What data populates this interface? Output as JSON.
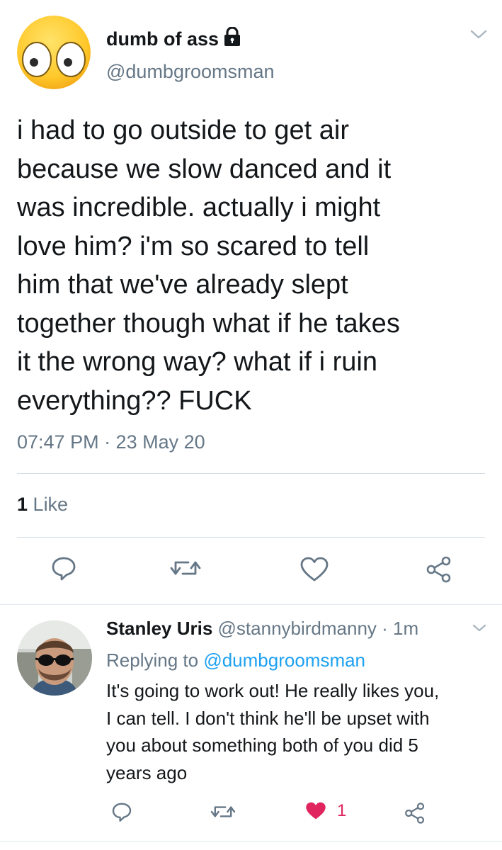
{
  "tweet": {
    "display_name": "dumb of ass",
    "handle": "@dumbgroomsman",
    "text": "i had to go outside to get air\nbecause we slow danced and it\nwas incredible. actually i might\nlove him? i'm so scared to tell\nhim that we've already slept\ntogether though what if he takes\nit the wrong way? what if i ruin\neverything?? FUCK",
    "timestamp": "07:47 PM · 23 May 20",
    "like_count": "1",
    "like_label": "Like",
    "protected_icon": "lock-icon",
    "avatar_icon": "surprised-face-emoji"
  },
  "actions": [
    "reply-icon",
    "retweet-icon",
    "like-icon",
    "share-icon"
  ],
  "reply": {
    "display_name": "Stanley Uris",
    "handle": "@stannybirdmanny",
    "time": "· 1m",
    "replying_label": "Replying to",
    "replying_to": "@dumbgroomsman",
    "text": "It's going to work out! He really likes you,\nI can tell. I don't think he'll be upset with\nyou about something both of you did 5\nyears ago",
    "like_count": "1",
    "avatar": "man-with-sunglasses-photo"
  },
  "colors": {
    "text": "#14171a",
    "secondary": "#657786",
    "link": "#1da1f2",
    "like_active": "#e0245e",
    "divider": "#d6dde3"
  }
}
